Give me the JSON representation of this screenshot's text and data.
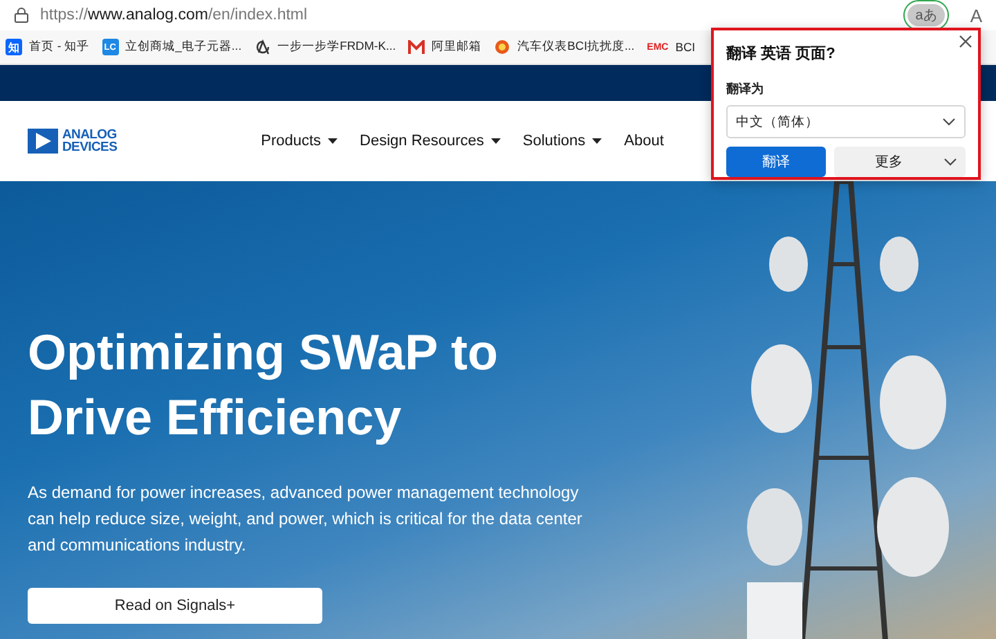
{
  "address_bar": {
    "url_parts": [
      {
        "text": "https://",
        "kind": "muted"
      },
      {
        "text": "www.analog.com",
        "kind": "host"
      },
      {
        "text": "/en/index.html",
        "kind": "muted"
      }
    ],
    "translate_badge": "aあ",
    "read_aloud": "A"
  },
  "bookmarks": [
    {
      "kind": "zhihu",
      "icon_text": "知",
      "label": "首页 - 知乎"
    },
    {
      "kind": "lc",
      "icon_text": "LC",
      "label": "立创商城_电子元器..."
    },
    {
      "kind": "swirl",
      "label": "一步一步学FRDM-K..."
    },
    {
      "kind": "mail",
      "label": "阿里邮箱"
    },
    {
      "kind": "seal",
      "label": "汽车仪表BCI抗扰度..."
    },
    {
      "kind": "emc",
      "icon_text": "EMC",
      "label": "BCI"
    }
  ],
  "site": {
    "logo": [
      "ANALOG",
      "DEVICES"
    ],
    "nav": [
      {
        "label": "Products"
      },
      {
        "label": "Design Resources"
      },
      {
        "label": "Solutions"
      },
      {
        "label": "About"
      }
    ]
  },
  "hero": {
    "title": "Optimizing SWaP to Drive Efficiency",
    "body": "As demand for power increases, advanced power management technology can help reduce size, weight, and power, which is critical for the data center and communications industry.",
    "cta": "Read on Signals+"
  },
  "translate_popup": {
    "title": "翻译 英语 页面?",
    "target_label": "翻译为",
    "target_value": "中文（简体）",
    "primary": "翻译",
    "secondary": "更多"
  }
}
